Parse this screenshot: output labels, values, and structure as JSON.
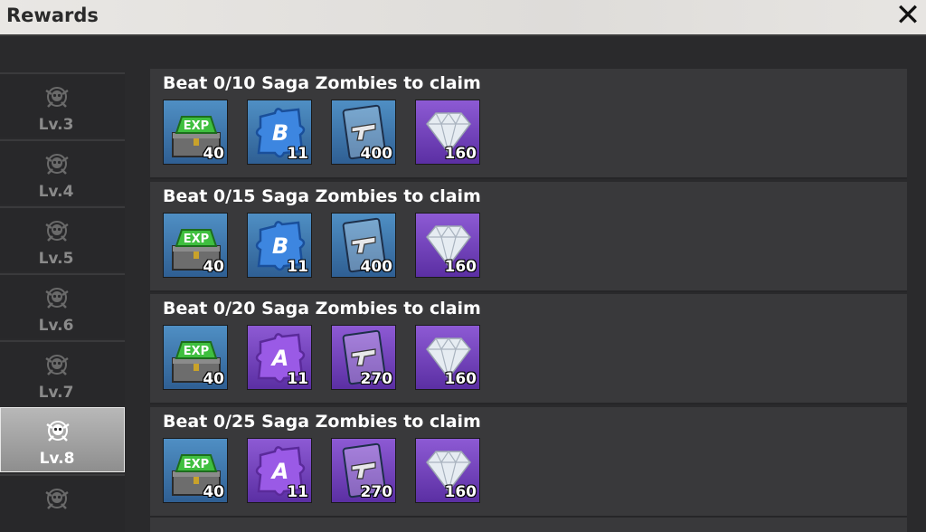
{
  "header": {
    "title": "Rewards",
    "close_icon": "close-icon"
  },
  "sidebar": {
    "levels": [
      {
        "label": "Lv.3",
        "active": false
      },
      {
        "label": "Lv.4",
        "active": false
      },
      {
        "label": "Lv.5",
        "active": false
      },
      {
        "label": "Lv.6",
        "active": false
      },
      {
        "label": "Lv.7",
        "active": false
      },
      {
        "label": "Lv.8",
        "active": true
      },
      {
        "label": "",
        "active": false
      }
    ]
  },
  "rewards": [
    {
      "title": "Beat 0/10 Saga Zombies to claim",
      "items": [
        {
          "icon": "exp-chest-icon",
          "qty": "40",
          "bg": "blue"
        },
        {
          "icon": "b-puzzle-icon",
          "qty": "11",
          "bg": "blue"
        },
        {
          "icon": "pistol-blueprint-icon",
          "qty": "400",
          "bg": "blue"
        },
        {
          "icon": "diamond-icon",
          "qty": "160",
          "bg": "purple"
        }
      ]
    },
    {
      "title": "Beat 0/15 Saga Zombies to claim",
      "items": [
        {
          "icon": "exp-chest-icon",
          "qty": "40",
          "bg": "blue"
        },
        {
          "icon": "b-puzzle-icon",
          "qty": "11",
          "bg": "blue"
        },
        {
          "icon": "pistol-blueprint-icon",
          "qty": "400",
          "bg": "blue"
        },
        {
          "icon": "diamond-icon",
          "qty": "160",
          "bg": "purple"
        }
      ]
    },
    {
      "title": "Beat 0/20 Saga Zombies to claim",
      "items": [
        {
          "icon": "exp-chest-icon",
          "qty": "40",
          "bg": "blue"
        },
        {
          "icon": "a-puzzle-icon",
          "qty": "11",
          "bg": "purple"
        },
        {
          "icon": "pistol-blueprint-icon",
          "qty": "270",
          "bg": "purple"
        },
        {
          "icon": "diamond-icon",
          "qty": "160",
          "bg": "purple"
        }
      ]
    },
    {
      "title": "Beat 0/25 Saga Zombies to claim",
      "items": [
        {
          "icon": "exp-chest-icon",
          "qty": "40",
          "bg": "blue"
        },
        {
          "icon": "a-puzzle-icon",
          "qty": "11",
          "bg": "purple"
        },
        {
          "icon": "pistol-blueprint-icon",
          "qty": "270",
          "bg": "purple"
        },
        {
          "icon": "diamond-icon",
          "qty": "160",
          "bg": "purple"
        }
      ]
    }
  ],
  "colors": {
    "blue_bg": "#3f78ad",
    "purple_bg": "#7444bd",
    "panel": "#39393b"
  }
}
